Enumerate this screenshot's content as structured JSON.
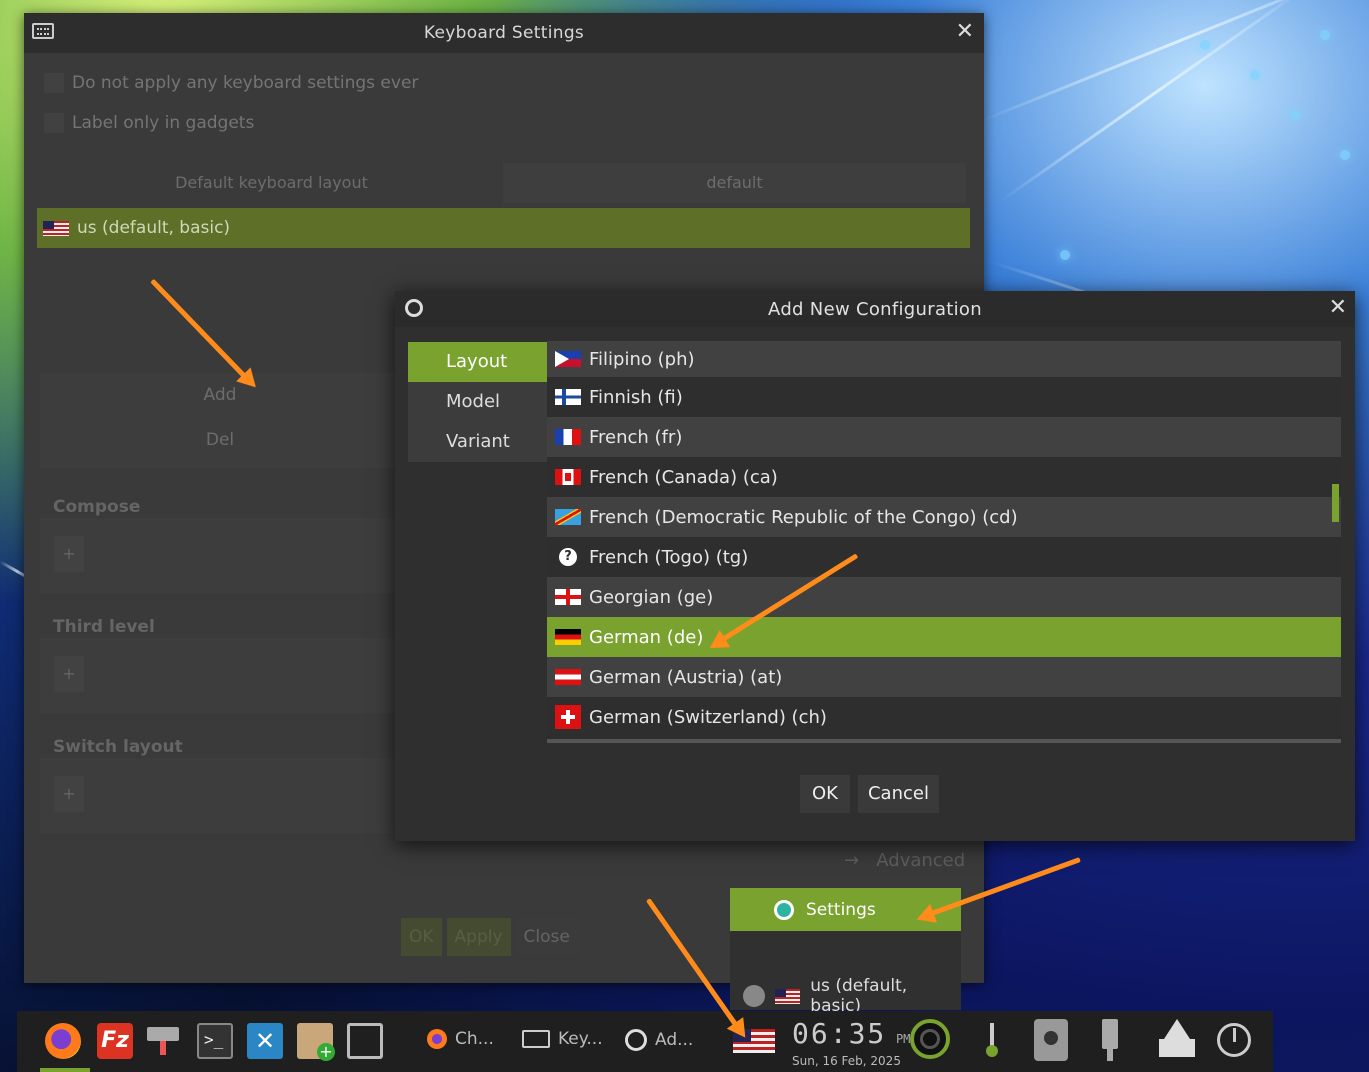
{
  "keyboard_settings": {
    "title": "Keyboard Settings",
    "close": "✕",
    "checkbox_no_apply": "Do not apply any keyboard settings ever",
    "checkbox_label_only": "Label only in gadgets",
    "header_layout": "Default keyboard layout",
    "header_default": "default",
    "current_layout": "us (default, basic)",
    "add_label": "Add",
    "del_label": "Del",
    "compose_title": "Compose",
    "third_level_title": "Third level",
    "switch_layout_title": "Switch layout",
    "plus": "+",
    "advanced_label": "Advanced",
    "ok_label": "OK",
    "apply_label": "Apply",
    "close_label": "Close"
  },
  "dialog": {
    "title": "Add New Configuration",
    "close": "✕",
    "tabs": [
      "Layout",
      "Model",
      "Variant"
    ],
    "active_tab": "Layout",
    "layouts": [
      {
        "label": "Filipino (ph)",
        "flag": "ph"
      },
      {
        "label": "Finnish (fi)",
        "flag": "fi"
      },
      {
        "label": "French (fr)",
        "flag": "fr"
      },
      {
        "label": "French (Canada) (ca)",
        "flag": "ca"
      },
      {
        "label": "French (Democratic Republic of the Congo) (cd)",
        "flag": "cd"
      },
      {
        "label": "French (Togo) (tg)",
        "flag": "unknown"
      },
      {
        "label": "Georgian (ge)",
        "flag": "ge"
      },
      {
        "label": "German (de)",
        "flag": "de"
      },
      {
        "label": "German (Austria) (at)",
        "flag": "at"
      },
      {
        "label": "German (Switzerland) (ch)",
        "flag": "ch"
      }
    ],
    "selected_layout": "German (de)",
    "ok_label": "OK",
    "cancel_label": "Cancel"
  },
  "tray_popup": {
    "settings_label": "Settings",
    "layout_label": "us (default, basic)"
  },
  "taskbar": {
    "tasks": [
      {
        "label": "Ch...",
        "icon": "firefox-icon"
      },
      {
        "label": "Key...",
        "icon": "keyboard-icon"
      },
      {
        "label": "Ad...",
        "icon": "config-icon"
      }
    ],
    "clock_time": "06:35",
    "clock_ampm": "PM",
    "clock_date": "Sun, 16 Feb, 2025"
  },
  "colors": {
    "accent": "#79a22f",
    "arrow": "#ff8c1a"
  }
}
